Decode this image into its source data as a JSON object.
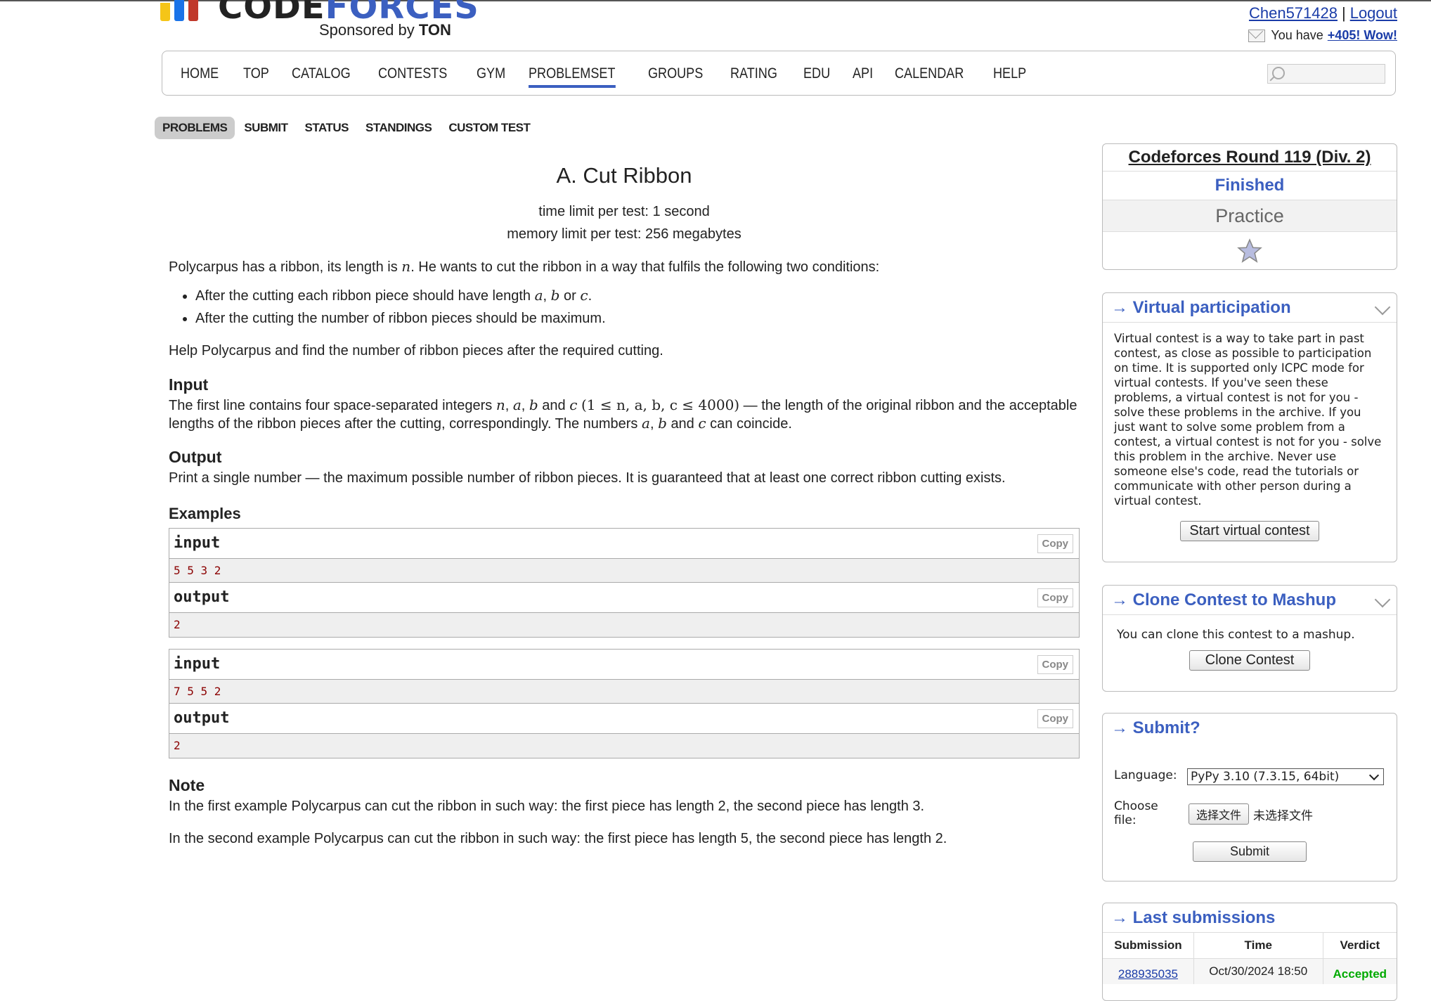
{
  "header": {
    "logo_main": "CODE",
    "logo_accent": "FORCES",
    "sponsor_prefix": "Sponsored by",
    "sponsor_name": "TON",
    "username": "Chen571428",
    "separator": "|",
    "logout": "Logout",
    "notice_text": "You have",
    "notice_link": "+405! Wow!"
  },
  "mainnav": [
    "HOME",
    "TOP",
    "CATALOG",
    "CONTESTS",
    "GYM",
    "PROBLEMSET",
    "GROUPS",
    "RATING",
    "EDU",
    "API",
    "CALENDAR",
    "HELP"
  ],
  "secnav": [
    "PROBLEMS",
    "SUBMIT",
    "STATUS",
    "STANDINGS",
    "CUSTOM TEST"
  ],
  "problem": {
    "title": "A. Cut Ribbon",
    "time_limit": "time limit per test: 1 second",
    "memory_limit": "memory limit per test: 256 megabytes",
    "stmt_a": "Polycarpus has a ribbon, its length is",
    "stmt_b": ". He wants to cut the ribbon in a way that fulfils the following two conditions:",
    "cond1_a": "After the cutting each ribbon piece should have length",
    "cond1_or": "or",
    "cond2": "After the cutting the number of ribbon pieces should be maximum.",
    "help": "Help Polycarpus and find the number of ribbon pieces after the required cutting.",
    "input_title": "Input",
    "input_a": "The first line contains four space-separated integers",
    "input_and": "and",
    "input_constraint": "(1 ≤ n, a, b, c ≤ 4000)",
    "input_b": "— the length of the original ribbon and the acceptable lengths of the ribbon pieces after the cutting, correspondingly. The numbers",
    "input_c": "can coincide.",
    "output_title": "Output",
    "output_text": "Print a single number — the maximum possible number of ribbon pieces. It is guaranteed that at least one correct ribbon cutting exists.",
    "examples_title": "Examples",
    "note_title": "Note",
    "note1": "In the first example Polycarpus can cut the ribbon in such way: the first piece has length 2, the second piece has length 3.",
    "note2": "In the second example Polycarpus can cut the ribbon in such way: the first piece has length 5, the second piece has length 2."
  },
  "vars": {
    "n": "n",
    "a": "a",
    "b": "b",
    "c": "c",
    "comma": ", "
  },
  "examples": [
    {
      "input_label": "input",
      "input": "5 5 3 2",
      "output_label": "output",
      "output": "2",
      "copy": "Copy"
    },
    {
      "input_label": "input",
      "input": "7 5 5 2",
      "output_label": "output",
      "output": "2",
      "copy": "Copy"
    }
  ],
  "sidebar": {
    "contest_name": "Codeforces Round 119 (Div. 2)",
    "contest_status": "Finished",
    "contest_mode": "Practice",
    "virtual_title": "→ Virtual participation",
    "virtual_text": "Virtual contest is a way to take part in past contest, as close as possible to participation on time. It is supported only ICPC mode for virtual contests. If you've seen these problems, a virtual contest is not for you - solve these problems in the archive. If you just want to solve some problem from a contest, a virtual contest is not for you - solve this problem in the archive. Never use someone else's code, read the tutorials or communicate with other person during a virtual contest.",
    "virtual_button": "Start virtual contest",
    "clone_title": "→ Clone Contest to Mashup",
    "clone_text": "You can clone this contest to a mashup.",
    "clone_button": "Clone Contest",
    "submit_title": "→ Submit?",
    "language_label": "Language:",
    "language_value": "PyPy 3.10 (7.3.15, 64bit)",
    "file_label": "Choose file:",
    "file_button": "选择文件",
    "file_none": "未选择文件",
    "submit_button": "Submit",
    "last_title": "→ Last submissions",
    "table_headers": [
      "Submission",
      "Time",
      "Verdict"
    ],
    "rows": [
      {
        "id": "288935035",
        "time": "Oct/30/2024 18:50",
        "verdict": "Accepted"
      }
    ]
  },
  "colors": {
    "accent": "#3b5fc0",
    "logo_yellow": "#f5c518",
    "logo_blue": "#1a73e8",
    "logo_red": "#c0392b",
    "accepted": "#0a0"
  }
}
